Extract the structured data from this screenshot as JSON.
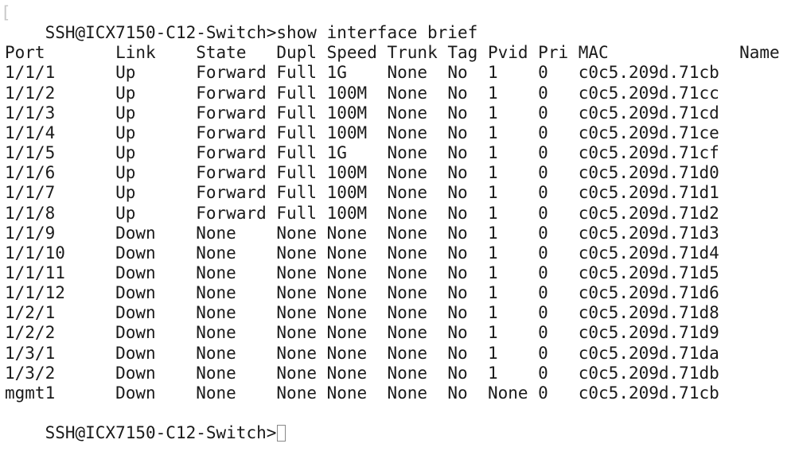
{
  "terminal": {
    "prompt": "SSH@ICX7150-C12-Switch>",
    "command": "show interface brief",
    "columns": [
      "Port",
      "Link",
      "State",
      "Dupl",
      "Speed",
      "Trunk",
      "Tag",
      "Pvid",
      "Pri",
      "MAC",
      "Name"
    ],
    "rows": [
      [
        "1/1/1",
        "Up",
        "Forward",
        "Full",
        "1G",
        "None",
        "No",
        "1",
        "0",
        "c0c5.209d.71cb",
        ""
      ],
      [
        "1/1/2",
        "Up",
        "Forward",
        "Full",
        "100M",
        "None",
        "No",
        "1",
        "0",
        "c0c5.209d.71cc",
        ""
      ],
      [
        "1/1/3",
        "Up",
        "Forward",
        "Full",
        "100M",
        "None",
        "No",
        "1",
        "0",
        "c0c5.209d.71cd",
        ""
      ],
      [
        "1/1/4",
        "Up",
        "Forward",
        "Full",
        "100M",
        "None",
        "No",
        "1",
        "0",
        "c0c5.209d.71ce",
        ""
      ],
      [
        "1/1/5",
        "Up",
        "Forward",
        "Full",
        "1G",
        "None",
        "No",
        "1",
        "0",
        "c0c5.209d.71cf",
        ""
      ],
      [
        "1/1/6",
        "Up",
        "Forward",
        "Full",
        "100M",
        "None",
        "No",
        "1",
        "0",
        "c0c5.209d.71d0",
        ""
      ],
      [
        "1/1/7",
        "Up",
        "Forward",
        "Full",
        "100M",
        "None",
        "No",
        "1",
        "0",
        "c0c5.209d.71d1",
        ""
      ],
      [
        "1/1/8",
        "Up",
        "Forward",
        "Full",
        "100M",
        "None",
        "No",
        "1",
        "0",
        "c0c5.209d.71d2",
        ""
      ],
      [
        "1/1/9",
        "Down",
        "None",
        "None",
        "None",
        "None",
        "No",
        "1",
        "0",
        "c0c5.209d.71d3",
        ""
      ],
      [
        "1/1/10",
        "Down",
        "None",
        "None",
        "None",
        "None",
        "No",
        "1",
        "0",
        "c0c5.209d.71d4",
        ""
      ],
      [
        "1/1/11",
        "Down",
        "None",
        "None",
        "None",
        "None",
        "No",
        "1",
        "0",
        "c0c5.209d.71d5",
        ""
      ],
      [
        "1/1/12",
        "Down",
        "None",
        "None",
        "None",
        "None",
        "No",
        "1",
        "0",
        "c0c5.209d.71d6",
        ""
      ],
      [
        "1/2/1",
        "Down",
        "None",
        "None",
        "None",
        "None",
        "No",
        "1",
        "0",
        "c0c5.209d.71d8",
        ""
      ],
      [
        "1/2/2",
        "Down",
        "None",
        "None",
        "None",
        "None",
        "No",
        "1",
        "0",
        "c0c5.209d.71d9",
        ""
      ],
      [
        "1/3/1",
        "Down",
        "None",
        "None",
        "None",
        "None",
        "No",
        "1",
        "0",
        "c0c5.209d.71da",
        ""
      ],
      [
        "1/3/2",
        "Down",
        "None",
        "None",
        "None",
        "None",
        "No",
        "1",
        "0",
        "c0c5.209d.71db",
        ""
      ],
      [
        "mgmt1",
        "Down",
        "None",
        "None",
        "None",
        "None",
        "No",
        "None",
        "0",
        "c0c5.209d.71cb",
        ""
      ]
    ]
  }
}
